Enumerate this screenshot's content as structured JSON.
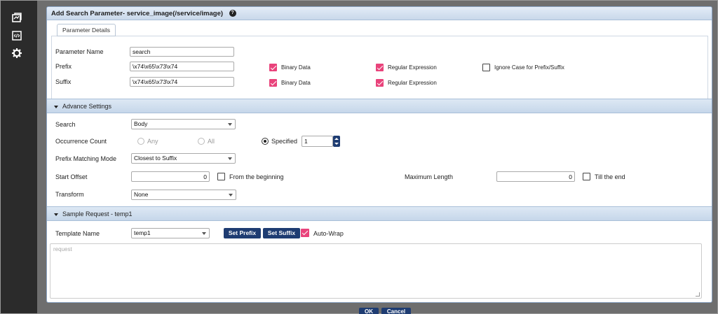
{
  "sidebar": {
    "items": [
      {
        "icon": "transactions-icon"
      },
      {
        "icon": "code-editor-icon"
      },
      {
        "icon": "gear-icon"
      }
    ]
  },
  "dialog": {
    "title": "Add Search Parameter- service_image(/service/image)",
    "help_icon": "help-icon"
  },
  "details": {
    "tab_label": "Parameter Details",
    "param_name_label": "Parameter Name",
    "param_name_value": "search",
    "prefix_label": "Prefix",
    "prefix_value": "\\x74\\x65\\x73\\x74",
    "prefix_binary_label": "Binary Data",
    "prefix_binary_checked": true,
    "prefix_regex_label": "Regular Expression",
    "prefix_regex_checked": true,
    "ignore_case_label": "Ignore Case for Prefix/Suffix",
    "ignore_case_checked": false,
    "suffix_label": "Suffix",
    "suffix_value": "\\x74\\x65\\x73\\x74",
    "suffix_binary_label": "Binary Data",
    "suffix_binary_checked": true,
    "suffix_regex_label": "Regular Expression",
    "suffix_regex_checked": true
  },
  "advance": {
    "header": "Advance Settings",
    "search_label": "Search",
    "search_value": "Body",
    "occurrence_label": "Occurrence Count",
    "occ_any": "Any",
    "occ_all": "All",
    "occ_specified": "Specified",
    "occ_selected": "Specified",
    "occ_count": "1",
    "prefix_mode_label": "Prefix Matching Mode",
    "prefix_mode_value": "Closest to Suffix",
    "start_offset_label": "Start Offset",
    "start_offset_value": "0",
    "from_beginning_label": "From the beginning",
    "from_beginning_checked": false,
    "max_length_label": "Maximum Length",
    "max_length_value": "0",
    "till_end_label": "Till the end",
    "till_end_checked": false,
    "transform_label": "Transform",
    "transform_value": "None"
  },
  "sample": {
    "header": "Sample Request - temp1",
    "template_label": "Template Name",
    "template_value": "temp1",
    "set_prefix": "Set Prefix",
    "set_suffix": "Set Suffix",
    "auto_wrap_label": "Auto-Wrap",
    "auto_wrap_checked": true,
    "request_placeholder": "request"
  },
  "footer": {
    "ok_label": "OK",
    "cancel_label": "Cancel"
  },
  "colors": {
    "sidebar_bg": "#2b2b2b",
    "accent_button": "#1e3c72",
    "checkbox_checked": "#e9437b",
    "section_header": "#c6d7ea"
  }
}
